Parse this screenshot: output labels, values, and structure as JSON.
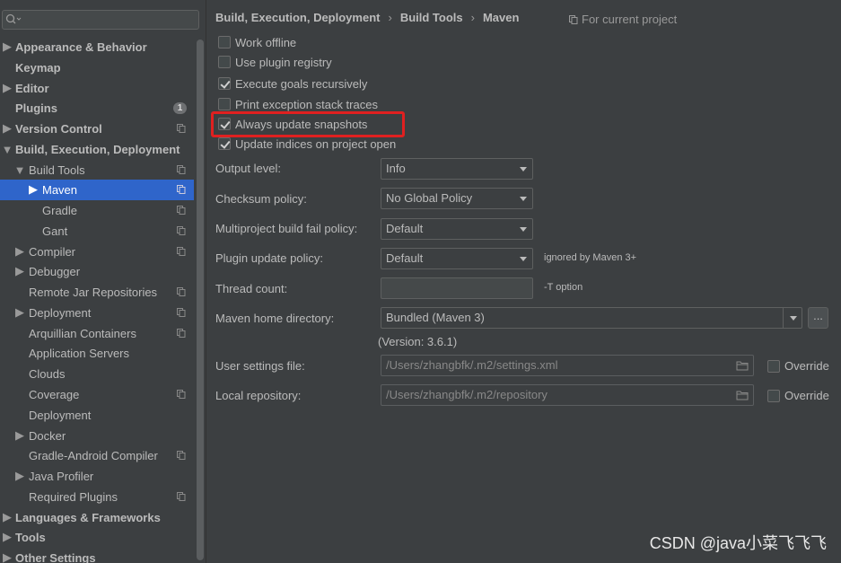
{
  "search": {
    "placeholder": ""
  },
  "sidebar": {
    "items": [
      {
        "label": "Appearance & Behavior"
      },
      {
        "label": "Keymap"
      },
      {
        "label": "Editor"
      },
      {
        "label": "Plugins",
        "badge": "1"
      },
      {
        "label": "Version Control"
      },
      {
        "label": "Build, Execution, Deployment"
      },
      {
        "label": "Build Tools"
      },
      {
        "label": "Maven"
      },
      {
        "label": "Gradle"
      },
      {
        "label": "Gant"
      },
      {
        "label": "Compiler"
      },
      {
        "label": "Debugger"
      },
      {
        "label": "Remote Jar Repositories"
      },
      {
        "label": "Deployment"
      },
      {
        "label": "Arquillian Containers"
      },
      {
        "label": "Application Servers"
      },
      {
        "label": "Clouds"
      },
      {
        "label": "Coverage"
      },
      {
        "label": "Deployment"
      },
      {
        "label": "Docker"
      },
      {
        "label": "Gradle-Android Compiler"
      },
      {
        "label": "Java Profiler"
      },
      {
        "label": "Required Plugins"
      },
      {
        "label": "Languages & Frameworks"
      },
      {
        "label": "Tools"
      },
      {
        "label": "Other Settings"
      }
    ]
  },
  "breadcrumb": {
    "items": [
      "Build, Execution, Deployment",
      "Build Tools",
      "Maven"
    ],
    "separator": "›"
  },
  "scope": {
    "label": "For current project"
  },
  "options": {
    "work_offline": {
      "label": "Work offline",
      "checked": false
    },
    "use_plugin_registry": {
      "label": "Use plugin registry",
      "checked": false
    },
    "execute_goals_recursively": {
      "label": "Execute goals recursively",
      "checked": true
    },
    "print_exception_stack_traces": {
      "label": "Print exception stack traces",
      "checked": false
    },
    "always_update_snapshots": {
      "label": "Always update snapshots",
      "checked": true
    },
    "update_indices": {
      "label": "Update indices on project open",
      "checked": true
    }
  },
  "fields": {
    "output_level": {
      "label": "Output level:",
      "value": "Info"
    },
    "checksum_policy": {
      "label": "Checksum policy:",
      "value": "No Global Policy"
    },
    "multiproject_fail_policy": {
      "label": "Multiproject build fail policy:",
      "value": "Default"
    },
    "plugin_update_policy": {
      "label": "Plugin update policy:",
      "value": "Default",
      "hint": "ignored by Maven 3+"
    },
    "thread_count": {
      "label": "Thread count:",
      "value": "",
      "hint": "-T option"
    },
    "maven_home": {
      "label": "Maven home directory:",
      "value": "Bundled (Maven 3)",
      "button": "...",
      "version": "(Version: 3.6.1)"
    },
    "user_settings": {
      "label": "User settings file:",
      "value": "/Users/zhangbfk/.m2/settings.xml",
      "override_label": "Override"
    },
    "local_repository": {
      "label": "Local repository:",
      "value": "/Users/zhangbfk/.m2/repository",
      "override_label": "Override"
    }
  },
  "watermark": "CSDN @java小菜飞飞飞",
  "colors": {
    "background": "#3c3f41",
    "selection": "#2f65ca",
    "highlight_box": "#e02020"
  }
}
